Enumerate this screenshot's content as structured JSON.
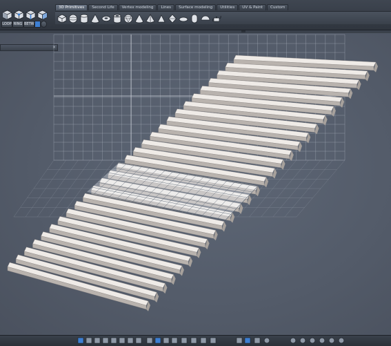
{
  "window": {
    "title": ""
  },
  "toolbar": {
    "mode_buttons": [
      {
        "label": "LOOP"
      },
      {
        "label": "RING"
      },
      {
        "label": "BETW"
      }
    ]
  },
  "tabs": [
    {
      "label": "3D Primitives",
      "active": true
    },
    {
      "label": "Second Life",
      "active": false
    },
    {
      "label": "Vertex modeling",
      "active": false
    },
    {
      "label": "Lines",
      "active": false
    },
    {
      "label": "Surface modeling",
      "active": false
    },
    {
      "label": "Utilities",
      "active": false
    },
    {
      "label": "UV & Paint",
      "active": false
    },
    {
      "label": "Custom",
      "active": false
    }
  ],
  "primitives": [
    "cube-icon",
    "sphere-icon",
    "cylinder-icon",
    "cone-icon",
    "torus-icon",
    "tube-icon",
    "geosphere-icon",
    "cone-icon",
    "pyramid-icon",
    "prism-icon",
    "octahedron-icon",
    "disk-icon",
    "capsule-icon",
    "hemisphere-icon",
    "teapot-icon"
  ],
  "viewport": {
    "panel_close": "×",
    "object": "staircase"
  },
  "colors": {
    "chrome_dark": "#2f353e",
    "viewport_bg": "#545d6b",
    "grid_line": "#a9b0bc",
    "stair_light": "#efebe7",
    "stair_shadow": "#b9b3ae",
    "accent_blue": "#3d7fd3"
  },
  "bottom_icons": [
    "view-single-icon",
    "view-split-h-icon",
    "view-split-v-icon",
    "view-quad-icon",
    "view-tri-icon",
    "view-four-icon",
    "grid-toggle-icon",
    "camera-icon",
    "wireframe-icon",
    "shaded-icon",
    "textured-icon",
    "snap-grid-icon",
    "frame-icon",
    "bounding-icon",
    "eye-icon",
    "axis-icon",
    "select-icon",
    "move-icon",
    "scale-icon",
    "globe-icon",
    "light-icon",
    "material-icon",
    "render-icon",
    "sphere-shade-icon",
    "preview-icon",
    "settings-icon"
  ]
}
